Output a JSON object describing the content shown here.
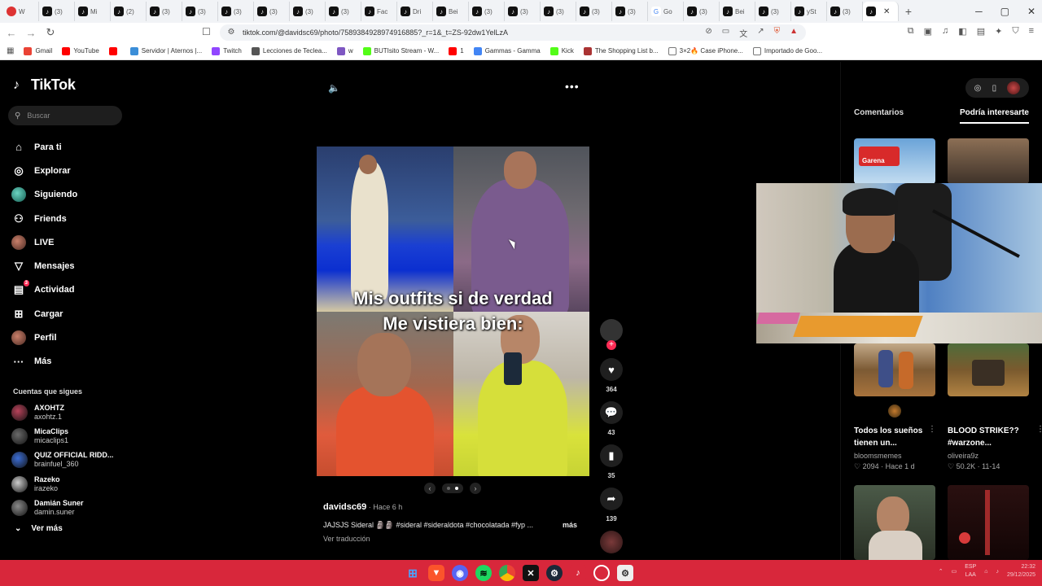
{
  "browser": {
    "tabs": [
      {
        "label": "W",
        "icon": "tiktok-icon"
      },
      {
        "label": "(3)",
        "icon": "tiktok-icon"
      },
      {
        "label": "Mi",
        "icon": "tiktok-icon"
      },
      {
        "label": "(2)",
        "icon": "tiktok-icon"
      },
      {
        "label": "(3)",
        "icon": "tiktok-icon"
      },
      {
        "label": "(3)",
        "icon": "tiktok-icon"
      },
      {
        "label": "(3)",
        "icon": "tiktok-icon"
      },
      {
        "label": "(3)",
        "icon": "tiktok-icon"
      },
      {
        "label": "(3)",
        "icon": "tiktok-icon"
      },
      {
        "label": "(3)",
        "icon": "tiktok-icon"
      },
      {
        "label": "Fac",
        "icon": "tiktok-icon"
      },
      {
        "label": "Dri",
        "icon": "tiktok-icon"
      },
      {
        "label": "Bei",
        "icon": "tiktok-icon"
      },
      {
        "label": "(3)",
        "icon": "tiktok-icon"
      },
      {
        "label": "(3)",
        "icon": "tiktok-icon"
      },
      {
        "label": "(3)",
        "icon": "tiktok-icon"
      },
      {
        "label": "(3)",
        "icon": "tiktok-icon"
      },
      {
        "label": "(3)",
        "icon": "tiktok-icon"
      },
      {
        "label": "Go",
        "icon": "google-icon"
      },
      {
        "label": "(3)",
        "icon": "tiktok-icon"
      },
      {
        "label": "Bei",
        "icon": "tiktok-icon"
      },
      {
        "label": "(3)",
        "icon": "tiktok-icon"
      },
      {
        "label": "ySt",
        "icon": "tiktok-icon"
      },
      {
        "label": "(3)",
        "icon": "tiktok-icon"
      }
    ],
    "url": "tiktok.com/@davidsc69/photo/7589384928974916885?_r=1&_t=ZS-92dw1YelLzA",
    "bookmarks": [
      {
        "label": "Gmail",
        "color": "#ea4335"
      },
      {
        "label": "YouTube",
        "color": "#ff0000"
      },
      {
        "label": "",
        "color": "#ff0000"
      },
      {
        "label": "Servidor | Aternos |...",
        "color": "#3b8ed8"
      },
      {
        "label": "Twitch",
        "color": "#9146ff"
      },
      {
        "label": "Lecciones de Teclea...",
        "color": "#555555"
      },
      {
        "label": "w",
        "color": "#7e57c2"
      },
      {
        "label": "BUTIsito Stream - W...",
        "color": "#53fc18"
      },
      {
        "label": "1",
        "color": "#ff0000"
      },
      {
        "label": "Gammas - Gamma",
        "color": "#4285f4"
      },
      {
        "label": "Kick",
        "color": "#53fc18"
      },
      {
        "label": "The Shopping List b...",
        "color": "#a33"
      },
      {
        "label": "3×2🔥 Case iPhone...",
        "color": "#ffffff"
      },
      {
        "label": "Importado de Goo...",
        "color": "#ffffff"
      }
    ]
  },
  "sidebar": {
    "brand": "TikTok",
    "search_placeholder": "Buscar",
    "nav": [
      {
        "label": "Para ti",
        "icon": "home-icon"
      },
      {
        "label": "Explorar",
        "icon": "compass-icon"
      },
      {
        "label": "Siguiendo",
        "icon": "following-avatar-icon"
      },
      {
        "label": "Friends",
        "icon": "friends-icon"
      },
      {
        "label": "LIVE",
        "icon": "live-avatar-icon"
      },
      {
        "label": "Mensajes",
        "icon": "messages-icon"
      },
      {
        "label": "Actividad",
        "icon": "activity-icon",
        "badge": "3"
      },
      {
        "label": "Cargar",
        "icon": "upload-icon"
      },
      {
        "label": "Perfil",
        "icon": "profile-avatar-icon"
      },
      {
        "label": "Más",
        "icon": "more-icon"
      }
    ],
    "following_title": "Cuentas que sigues",
    "following": [
      {
        "name": "AXOHTZ",
        "user": "axohtz.1",
        "color": "#b8425a"
      },
      {
        "name": "MicaClips",
        "user": "micaclips1",
        "color": "#6a6a6a"
      },
      {
        "name": "QUIZ OFFICIAL RIDD...",
        "user": "brainfuel_360",
        "color": "#3c6ed6"
      },
      {
        "name": "Razeko",
        "user": "irazeko",
        "color": "#cccccc"
      },
      {
        "name": "Damián Suner",
        "user": "damin.suner",
        "color": "#8a8a8a"
      }
    ],
    "see_more": "Ver más"
  },
  "post": {
    "overlay_line1": "Mis outfits si de verdad",
    "overlay_line2": "Me vistiera bien:",
    "author": "davidsc69",
    "time": " · Hace 6 h",
    "description": "JAJSJS Sideral 🗿🗿 #sideral #sideraldota #chocolatada #fyp ...",
    "more": "más",
    "translate": "Ver traducción",
    "carousel_active": 2,
    "likes": "364",
    "comments": "43",
    "saves": "35",
    "shares": "139"
  },
  "right_panel": {
    "tabs": [
      "Comentarios",
      "Podría interesarte"
    ],
    "active_tab": "Podría interesarte",
    "cards": [
      {
        "title": "Todos los sueños tienen un...",
        "author": "bloomsmemes",
        "meta": "♡ 2094 · Hace 1 d"
      },
      {
        "title": "BLOOD STRIKE?? #warzone...",
        "author": "oliveira9z",
        "meta": "♡ 50.2K · 11-14"
      }
    ],
    "top_thumb_brand": "Garena"
  },
  "taskbar": {
    "lang_line1": "ESP",
    "lang_line2": "LAA",
    "time": "22:32",
    "date": "29/12/2025"
  },
  "colors": {
    "accent": "#fe2c55",
    "taskbar": "#d8273b"
  }
}
